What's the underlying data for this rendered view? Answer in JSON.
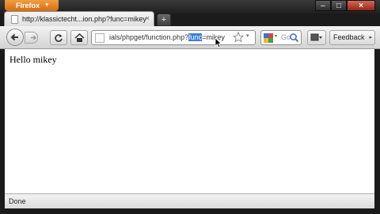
{
  "app": {
    "menu_button_label": "Firefox",
    "menu_arrow": "▾"
  },
  "window_controls": {
    "minimize": "–",
    "maximize": "□",
    "close": "×"
  },
  "tabs": [
    {
      "title": "http://klassictecht...ion.php?func=mikey",
      "close": "×"
    }
  ],
  "new_tab_label": "+",
  "navigation": {
    "url_prefix": "ials/phpget/function.php?",
    "url_selected": "func",
    "url_suffix": "=mikey"
  },
  "search": {
    "placeholder": "Go"
  },
  "feedback": {
    "label": "Feedback",
    "arrow": "▸"
  },
  "content": {
    "text": "Hello mikey"
  },
  "status": {
    "text": "Done"
  },
  "icons": [
    "back-arrow-icon",
    "forward-arrow-icon",
    "reload-icon",
    "home-icon",
    "bookmark-star-icon",
    "google-icon",
    "search-icon",
    "addon-icon",
    "mouse-cursor-icon"
  ],
  "colors": {
    "firefox_orange": "#e4801f",
    "selection_blue": "#3f7fd6",
    "chrome_dark": "#1b1b1b"
  }
}
